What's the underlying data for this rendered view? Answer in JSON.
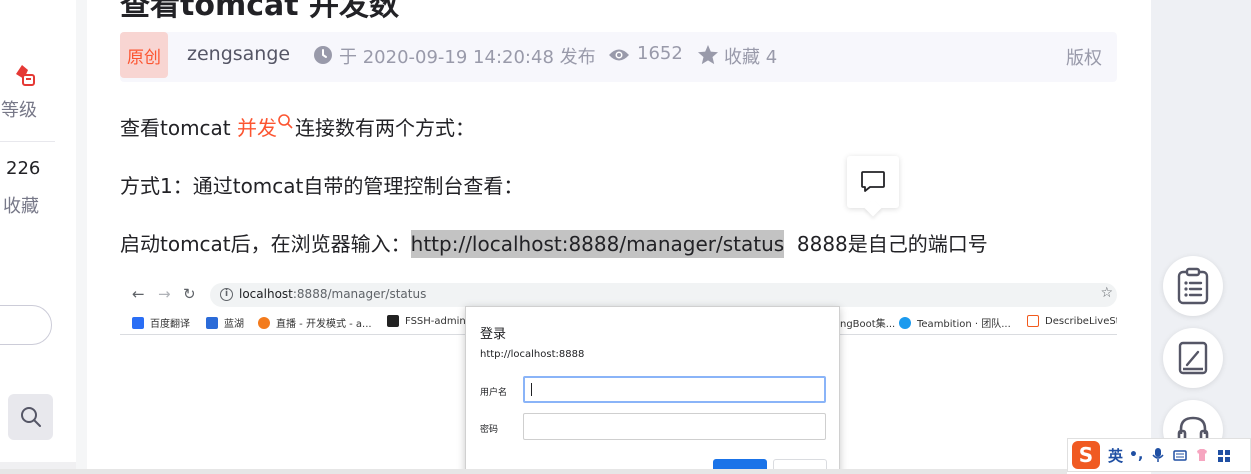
{
  "sidebar": {
    "level_label": "等级",
    "fav_count": "226",
    "fav_label": "收藏"
  },
  "article": {
    "title": "查看tomcat 并发数",
    "original_badge": "原创",
    "author": "zengsange",
    "publish_time": "于 2020-09-19 14:20:48 发布",
    "views": "1652",
    "favorites": "收藏 4",
    "copyright": "版权",
    "p1_before": "查看tomcat ",
    "p1_keyword": "并发",
    "p1_after": "连接数有两个方式：",
    "p2": "方式1：通过tomcat自带的管理控制台查看：",
    "p3_before": "启动tomcat后，在浏览器输入：",
    "p3_url": "http://localhost:8888/manager/status",
    "p3_after": "  8888是自己的端口号"
  },
  "embedded_browser": {
    "url_host": "localhost",
    "url_rest": ":8888/manager/status",
    "bookmarks": [
      {
        "label": "百度翻译",
        "color": "#2a6ef5"
      },
      {
        "label": "蓝湖",
        "color": "#2b6bd8"
      },
      {
        "label": "直播 - 开发模式 - a...",
        "color": "#f37b1d"
      },
      {
        "label": "FSSH-admin",
        "color": "#222222"
      },
      {
        "label": "ngBoot集...",
        "color": "#ffffff"
      },
      {
        "label": "Teambition · 团队...",
        "color": "#1b9aee"
      },
      {
        "label": "DescribeLiveSt",
        "color": "#f25a1c"
      }
    ],
    "dialog": {
      "title": "登录",
      "url": "http://localhost:8888",
      "username_label": "用户名",
      "password_label": "密码"
    }
  },
  "right_toolbar": {
    "buttons": [
      "catalog-icon",
      "edit-icon",
      "headset-icon"
    ]
  },
  "ime": {
    "logo": "S",
    "lang": "英",
    "punc": "•,"
  },
  "colors": {
    "accent": "#fc5531",
    "badge_bg": "#f8d5d2",
    "meta_text": "#999aaa",
    "link_highlight": "#c3c3c3",
    "chrome_blue": "#1a73e8"
  }
}
